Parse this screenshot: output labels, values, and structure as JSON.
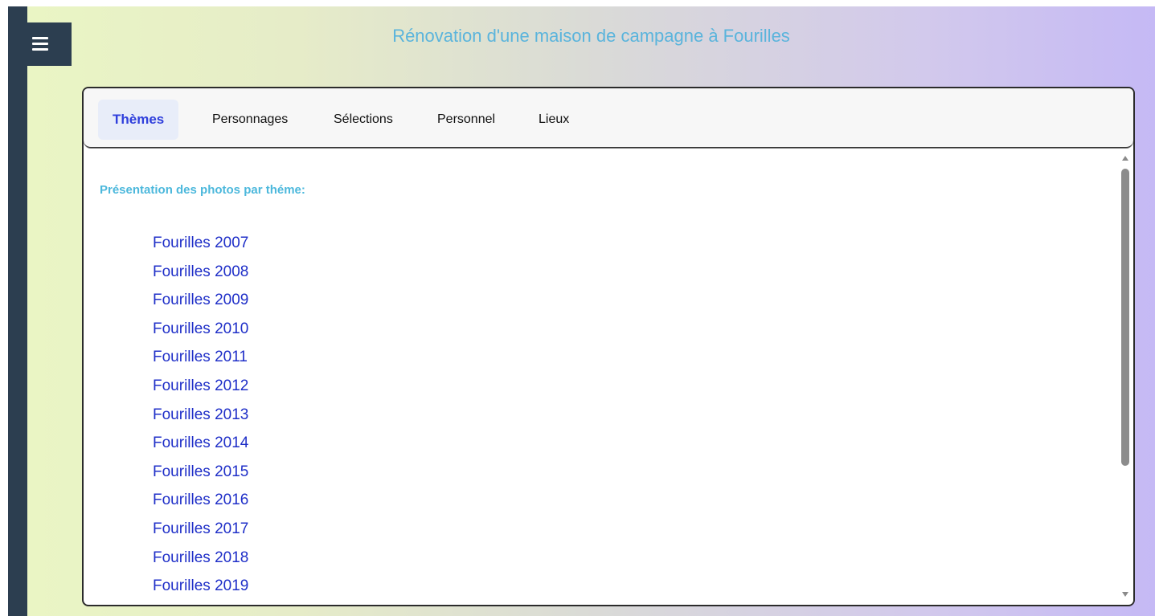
{
  "header": {
    "title": "Rénovation d'une maison de campagne à Fourilles",
    "menu_icon": "hamburger-menu-icon",
    "title_color": "#5ab4dc",
    "sidebar_color": "#2c3e50"
  },
  "tabs": [
    {
      "label": "Thèmes",
      "active": true
    },
    {
      "label": "Personnages",
      "active": false
    },
    {
      "label": "Sélections",
      "active": false
    },
    {
      "label": "Personnel",
      "active": false
    },
    {
      "label": "Lieux",
      "active": false
    }
  ],
  "content": {
    "heading": "Présentation des photos par théme:",
    "heading_color": "#4cb8dc",
    "link_color": "#1f2fc8",
    "themes": [
      "Fourilles 2007",
      "Fourilles 2008",
      "Fourilles 2009",
      "Fourilles 2010",
      "Fourilles 2011",
      "Fourilles 2012",
      "Fourilles 2013",
      "Fourilles 2014",
      "Fourilles 2015",
      "Fourilles 2016",
      "Fourilles 2017",
      "Fourilles 2018",
      "Fourilles 2019"
    ]
  }
}
